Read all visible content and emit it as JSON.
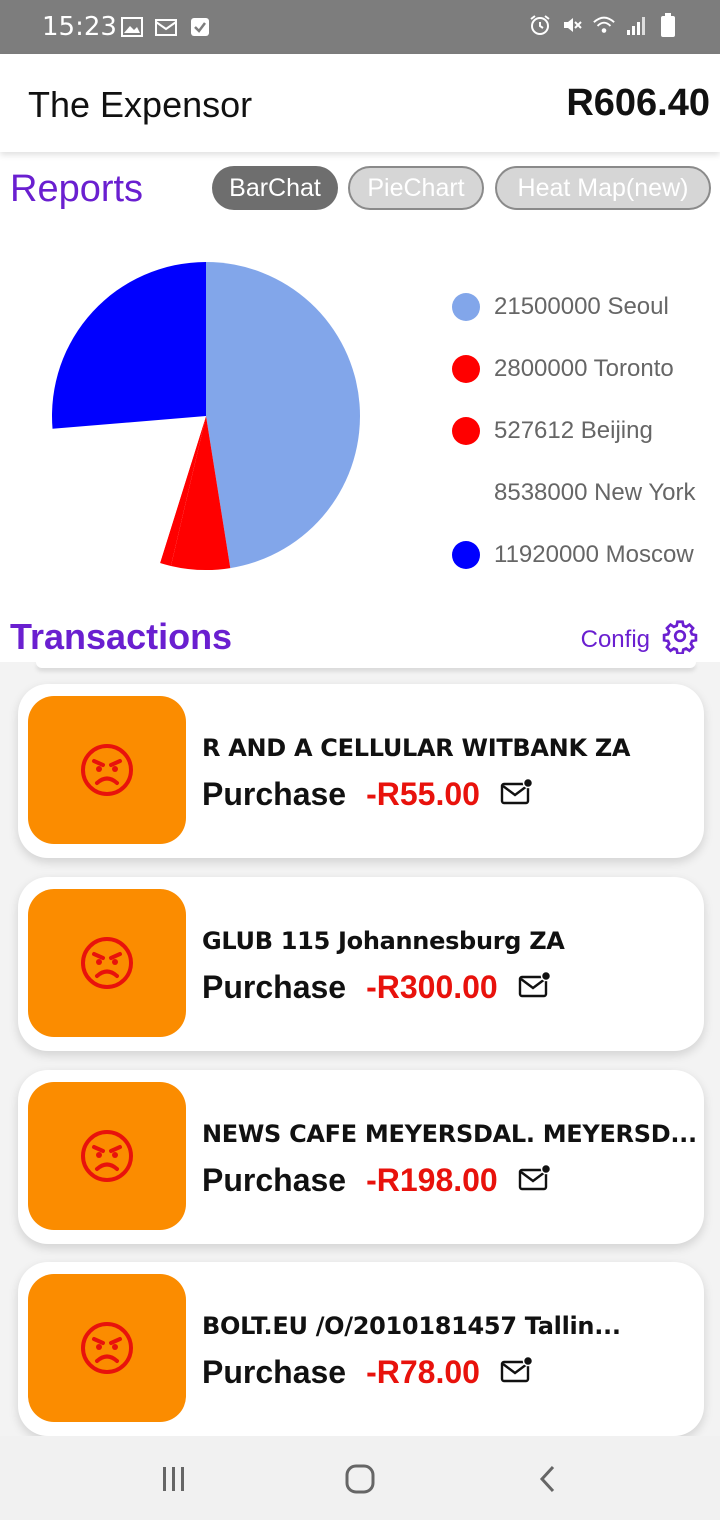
{
  "status_bar": {
    "time": "15:23",
    "left_icons": [
      "image-icon",
      "gallery-icon",
      "check-icon"
    ],
    "right_icons": [
      "alarm-icon",
      "mute-icon",
      "wifi-icon",
      "signal-icon",
      "battery-icon"
    ]
  },
  "app": {
    "title": "The Expensor",
    "balance": "R606.40"
  },
  "reports": {
    "title": "Reports",
    "tabs": [
      {
        "label": "BarChat",
        "selected": true
      },
      {
        "label": "PieChart",
        "selected": false
      },
      {
        "label": "Heat Map(new)",
        "selected": false
      }
    ]
  },
  "chart_data": {
    "type": "pie",
    "series": [
      {
        "label": "21500000 Seoul",
        "value": 21500000,
        "color": "#82a6ea"
      },
      {
        "label": "2800000 Toronto",
        "value": 2800000,
        "color": "#ff0000"
      },
      {
        "label": "527612 Beijing",
        "value": 527612,
        "color": "#ff0000"
      },
      {
        "label": "8538000 New York",
        "value": 8538000,
        "color": "#ffffff"
      },
      {
        "label": "11920000 Moscow",
        "value": 11920000,
        "color": "#0000ff"
      }
    ],
    "legend_position": "right"
  },
  "transactions": {
    "title": "Transactions",
    "config_label": "Config",
    "items": [
      {
        "merchant": "R AND A CELLULAR WITBANK ZA",
        "type": "Purchase",
        "amount": "-R55.00",
        "icon": "angry-face-icon"
      },
      {
        "merchant": "GLUB 115 Johannesburg ZA",
        "type": "Purchase",
        "amount": "-R300.00",
        "icon": "angry-face-icon"
      },
      {
        "merchant": "NEWS CAFE MEYERSDAL. MEYERSD...",
        "type": "Purchase",
        "amount": "-R198.00",
        "icon": "angry-face-icon"
      },
      {
        "merchant": "BOLT.EU /O/2010181457 Tallin...",
        "type": "Purchase",
        "amount": "-R78.00",
        "icon": "angry-face-icon"
      }
    ]
  },
  "colors": {
    "accent": "#6a1fd0",
    "negative_amount": "#e8120c",
    "thumb": "#fb8c00"
  },
  "navbar": {
    "buttons": [
      "recents-icon",
      "home-icon",
      "back-icon"
    ]
  }
}
